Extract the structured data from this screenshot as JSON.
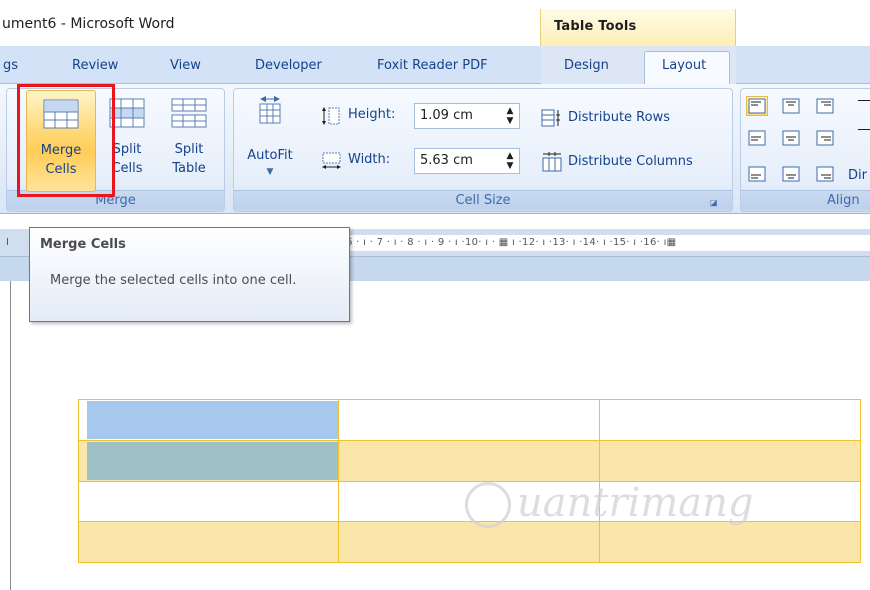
{
  "window": {
    "title": "ument6 - Microsoft Word"
  },
  "contextual": {
    "label": "Table Tools"
  },
  "tabs": [
    {
      "label": "gs"
    },
    {
      "label": "Review"
    },
    {
      "label": "View"
    },
    {
      "label": "Developer"
    },
    {
      "label": "Foxit Reader PDF"
    },
    {
      "label": "Design"
    },
    {
      "label": "Layout",
      "active": true
    }
  ],
  "groups": {
    "merge": {
      "label": "Merge",
      "buttons": [
        {
          "label_line1": "Merge",
          "label_line2": "Cells",
          "highlighted": true
        },
        {
          "label_line1": "Split",
          "label_line2": "Cells"
        },
        {
          "label_line1": "Split",
          "label_line2": "Table"
        }
      ]
    },
    "cellsize": {
      "label": "Cell Size",
      "autofit_label": "AutoFit",
      "height_label": "Height:",
      "height_value": "1.09 cm",
      "width_label": "Width:",
      "width_value": "5.63 cm",
      "distribute_rows": "Distribute Rows",
      "distribute_columns": "Distribute Columns"
    },
    "alignment": {
      "label": "Align",
      "direction_fragment": "Dir"
    }
  },
  "ruler": {
    "left_mark": "I",
    "marks": "6 · ı · 7 · ı · 8 · ı · 9 · ı ·10· ı · ▦ ı ·12· ı ·13· ı ·14· ı ·15· ı ·16· ı▦"
  },
  "tooltip": {
    "title": "Merge Cells",
    "body": "Merge the selected cells into one cell."
  },
  "watermark": {
    "text": "uantrimang"
  },
  "colors": {
    "accent_highlight": "#e8171d",
    "selected_cell": "#a6c8ec",
    "table_border": "#f2c12e",
    "shaded_row": "#fbe6a9"
  }
}
